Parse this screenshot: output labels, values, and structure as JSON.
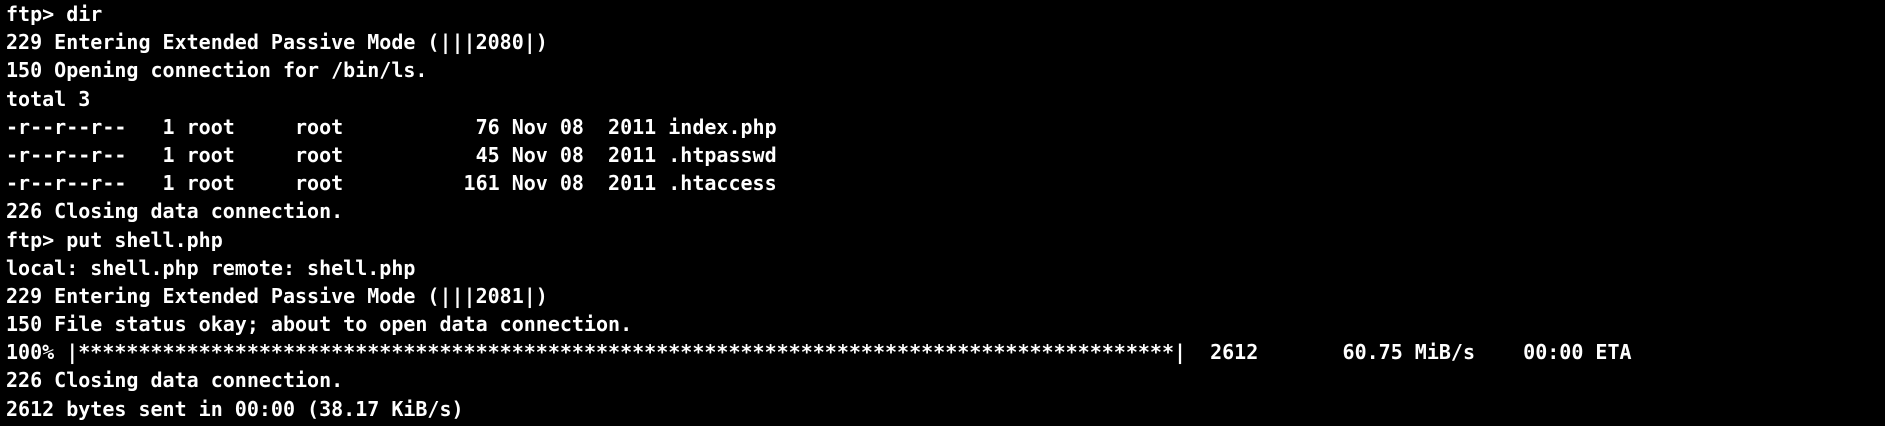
{
  "terminal": {
    "lines": [
      "ftp> dir",
      "229 Entering Extended Passive Mode (|||2080|)",
      "150 Opening connection for /bin/ls.",
      "total 3",
      "-r--r--r--   1 root     root           76 Nov 08  2011 index.php",
      "-r--r--r--   1 root     root           45 Nov 08  2011 .htpasswd",
      "-r--r--r--   1 root     root          161 Nov 08  2011 .htaccess",
      "226 Closing data connection.",
      "ftp> put shell.php",
      "local: shell.php remote: shell.php",
      "229 Entering Extended Passive Mode (|||2081|)",
      "150 File status okay; about to open data connection.",
      "100% |*******************************************************************************************|  2612       60.75 MiB/s    00:00 ETA",
      "226 Closing data connection.",
      "2612 bytes sent in 00:00 (38.17 KiB/s)"
    ]
  }
}
